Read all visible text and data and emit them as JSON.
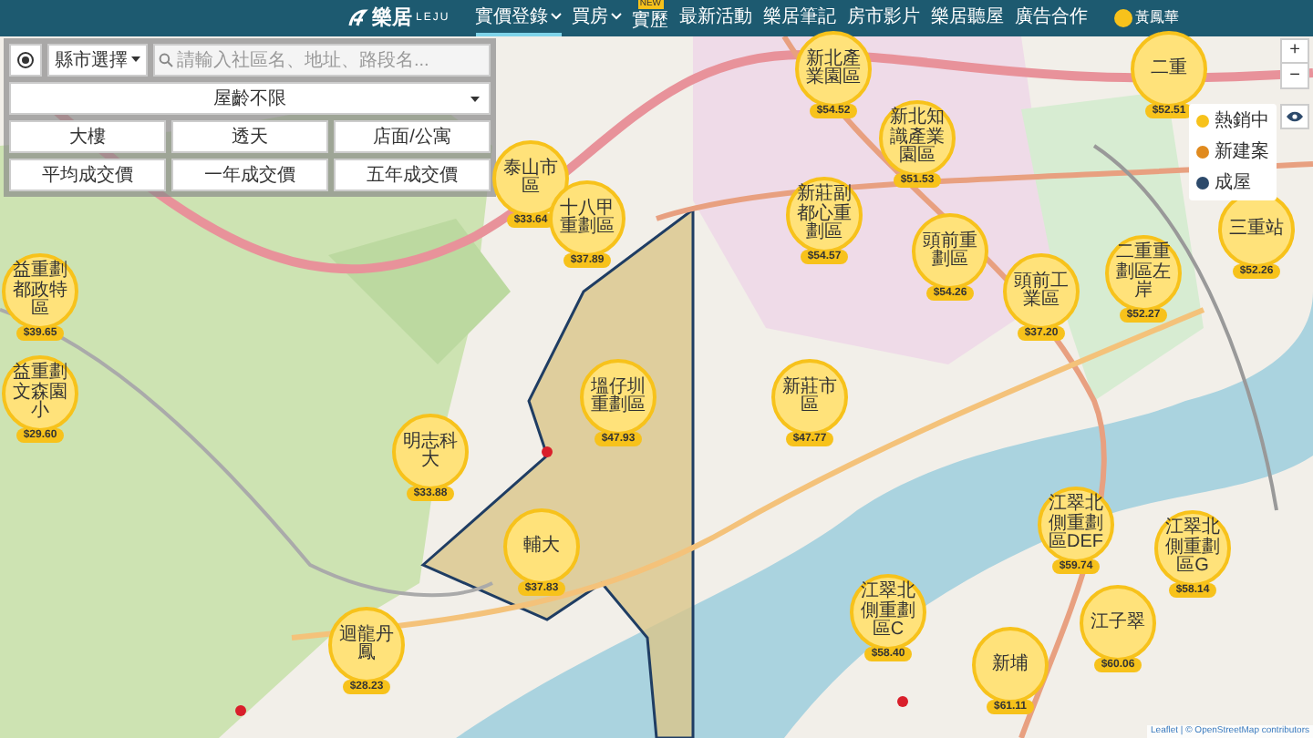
{
  "header": {
    "logo": {
      "name": "樂居",
      "sub": "LEJU"
    },
    "nav": [
      {
        "label": "實價登錄",
        "selected": true,
        "menu": true
      },
      {
        "label": "買房",
        "selected": false,
        "menu": true
      },
      {
        "label": "實歷",
        "selected": false,
        "menu": false,
        "badge": "NEW"
      },
      {
        "label": "最新活動",
        "selected": false,
        "menu": false
      },
      {
        "label": "樂居筆記",
        "selected": false,
        "menu": false
      },
      {
        "label": "房市影片",
        "selected": false,
        "menu": false
      },
      {
        "label": "樂居聽屋",
        "selected": false,
        "menu": false
      },
      {
        "label": "廣告合作",
        "selected": false,
        "menu": false
      }
    ],
    "user": {
      "name": "黃鳳華"
    }
  },
  "filters": {
    "city": "縣市選擇",
    "search": {
      "placeholder": "請輸入社區名、地址、路段名..."
    },
    "age": "屋齡不限",
    "types": [
      {
        "label": "大樓",
        "selected": false
      },
      {
        "label": "透天",
        "selected": false
      },
      {
        "label": "店面/公寓",
        "selected": false
      }
    ],
    "prices": [
      {
        "label": "平均成交價",
        "selected": false
      },
      {
        "label": "一年成交價",
        "selected": false
      },
      {
        "label": "五年成交價",
        "selected": false
      }
    ]
  },
  "map": {
    "zoom": {
      "in": "+",
      "out": "−"
    },
    "legend": [
      {
        "label": "熱銷中",
        "color": "#f7c21b"
      },
      {
        "label": "新建案",
        "color": "#e08a1e"
      },
      {
        "label": "成屋",
        "color": "#2d4a6b"
      }
    ],
    "pins": [
      {
        "name": "新北產業園區",
        "price": "$54.52"
      },
      {
        "name": "二重",
        "price": "$52.51"
      },
      {
        "name": "新北知識產業園區",
        "price": "$51.53"
      },
      {
        "name": "泰山市區",
        "price": "$33.64"
      },
      {
        "name": "十八甲重劃區",
        "price": "$37.89"
      },
      {
        "name": "新莊副都心重劃區",
        "price": "$54.57"
      },
      {
        "name": "三重站",
        "price": "$52.26"
      },
      {
        "name": "益重劃都政特區",
        "price": "$39.65"
      },
      {
        "name": "頭前重劃區",
        "price": "$54.26"
      },
      {
        "name": "頭前工業區",
        "price": "$37.20"
      },
      {
        "name": "二重重劃區左岸",
        "price": "$52.27"
      },
      {
        "name": "益重劃文森園小",
        "price": "$29.60"
      },
      {
        "name": "塭仔圳重劃區",
        "price": "$47.93"
      },
      {
        "name": "新莊市區",
        "price": "$47.77"
      },
      {
        "name": "明志科大",
        "price": "$33.88"
      },
      {
        "name": "輔大",
        "price": "$37.83"
      },
      {
        "name": "江翠北側重劃區DEF",
        "price": "$59.74"
      },
      {
        "name": "江翠北側重劃區G",
        "price": "$58.14"
      },
      {
        "name": "迴龍丹鳳",
        "price": "$28.23"
      },
      {
        "name": "江翠北側重劃區C",
        "price": "$58.40"
      },
      {
        "name": "新埔",
        "price": "$61.11"
      },
      {
        "name": "江子翠",
        "price": "$60.06"
      }
    ],
    "attribution": "Leaflet | © OpenStreetMap contributors"
  }
}
